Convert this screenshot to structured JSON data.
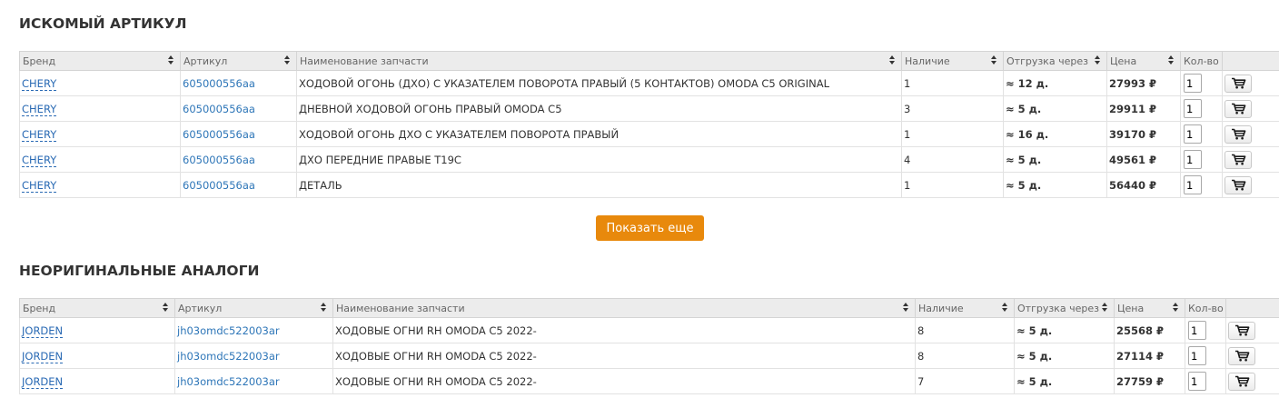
{
  "sections": {
    "original_title": "ИСКОМЫЙ АРТИКУЛ",
    "analogs_title": "НЕОРИГИНАЛЬНЫЕ АНАЛОГИ"
  },
  "columns": {
    "brand": "Бренд",
    "article": "Артикул",
    "name": "Наименование запчасти",
    "stock": "Наличие",
    "delivery": "Отгрузка через",
    "price": "Цена",
    "qty": "Кол-во"
  },
  "original_rows": [
    {
      "brand": "CHERY",
      "article": "605000556aa",
      "name": "ХОДОВОЙ ОГОНЬ (ДХО) С УКАЗАТЕЛЕМ ПОВОРОТА ПРАВЫЙ (5 КОНТАКТОВ) OMODA C5 ORIGINAL",
      "stock": "1",
      "delivery": "≈ 12 д.",
      "price": "27993 ₽",
      "qty": "1"
    },
    {
      "brand": "CHERY",
      "article": "605000556aa",
      "name": "ДНЕВНОЙ ХОДОВОЙ ОГОНЬ ПРАВЫЙ OMODA C5",
      "stock": "3",
      "delivery": "≈ 5 д.",
      "price": "29911 ₽",
      "qty": "1"
    },
    {
      "brand": "CHERY",
      "article": "605000556aa",
      "name": "ХОДОВОЙ ОГОНЬ ДХО С УКАЗАТЕЛЕМ ПОВОРОТА ПРАВЫЙ",
      "stock": "1",
      "delivery": "≈ 16 д.",
      "price": "39170 ₽",
      "qty": "1"
    },
    {
      "brand": "CHERY",
      "article": "605000556aa",
      "name": "ДХО ПЕРЕДНИЕ ПРАВЫЕ T19C",
      "stock": "4",
      "delivery": "≈ 5 д.",
      "price": "49561 ₽",
      "qty": "1"
    },
    {
      "brand": "CHERY",
      "article": "605000556aa",
      "name": "ДЕТАЛЬ",
      "stock": "1",
      "delivery": "≈ 5 д.",
      "price": "56440 ₽",
      "qty": "1"
    }
  ],
  "show_more_label": "Показать еще",
  "analog_rows": [
    {
      "brand": "JORDEN",
      "article": "jh03omdc522003ar",
      "name": "ХОДОВЫЕ ОГНИ RH OMODA C5 2022-",
      "stock": "8",
      "delivery": "≈ 5 д.",
      "price": "25568 ₽",
      "qty": "1"
    },
    {
      "brand": "JORDEN",
      "article": "jh03omdc522003ar",
      "name": "ХОДОВЫЕ ОГНИ RH OMODA C5 2022-",
      "stock": "8",
      "delivery": "≈ 5 д.",
      "price": "27114 ₽",
      "qty": "1"
    },
    {
      "brand": "JORDEN",
      "article": "jh03omdc522003ar",
      "name": "ХОДОВЫЕ ОГНИ RH OMODA C5 2022-",
      "stock": "7",
      "delivery": "≈ 5 д.",
      "price": "27759 ₽",
      "qty": "1"
    }
  ],
  "icons": {
    "cart": "shopping-cart-icon",
    "sort": "sort-arrows-icon"
  },
  "colors": {
    "accent": "#e8890c",
    "link": "#2a6ab4",
    "header_bg": "#ececec"
  }
}
